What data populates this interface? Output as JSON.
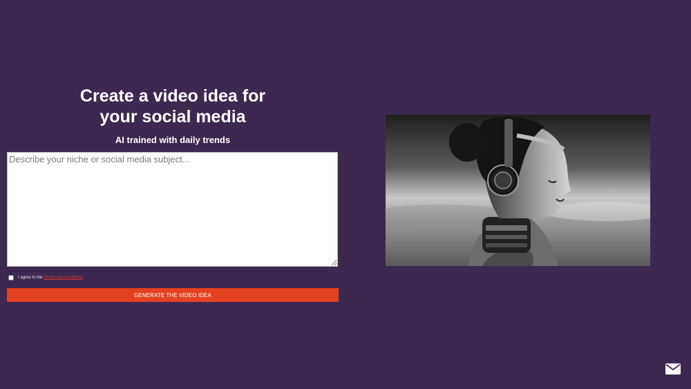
{
  "heading": {
    "line1": "Create a video idea for",
    "line2": "your social media",
    "subtitle": "AI trained with daily trends"
  },
  "form": {
    "placeholder": "Describe your niche or social media subject...",
    "agree_text": "I agree to the",
    "agree_link": "Terms and conditions",
    "submit_label": "GENERATE THE VIDEO IDEA"
  },
  "colors": {
    "background": "#3d2950",
    "accent": "#e44121"
  },
  "icons": {
    "contact": "envelope-icon"
  }
}
